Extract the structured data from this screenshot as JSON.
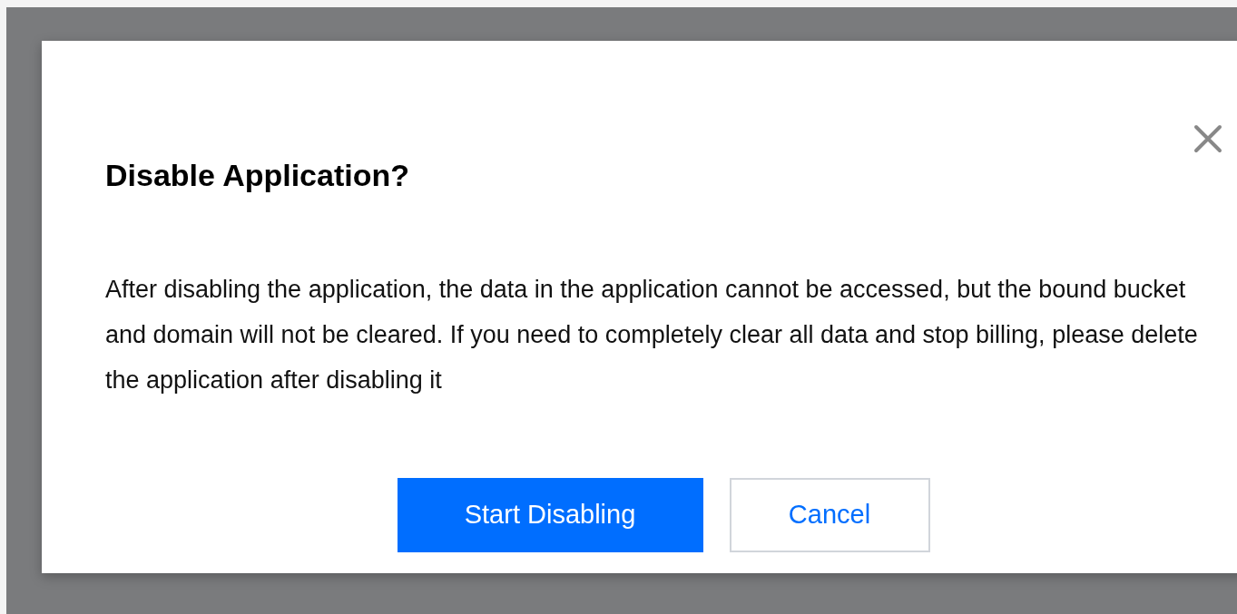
{
  "dialog": {
    "title": "Disable Application?",
    "message": "After disabling the application, the data in the application cannot be accessed, but the bound bucket and domain will not be cleared. If you need to completely clear all data and stop billing, please delete the application after disabling it",
    "buttons": [
      {
        "label": "Start Disabling",
        "kind": "primary"
      },
      {
        "label": "Cancel",
        "kind": "secondary"
      }
    ]
  }
}
